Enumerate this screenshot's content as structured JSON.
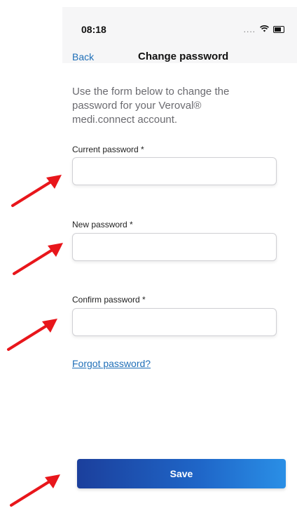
{
  "status_bar": {
    "time": "08:18",
    "signal": "....",
    "wifi_icon": "wifi-icon",
    "battery_icon": "battery-icon"
  },
  "nav": {
    "back_label": "Back",
    "title": "Change password"
  },
  "intro": "Use the form below to change the password for your Veroval® medi.connect account.",
  "fields": {
    "current": {
      "label": "Current password *",
      "value": ""
    },
    "new": {
      "label": "New password *",
      "value": ""
    },
    "confirm": {
      "label": "Confirm password *",
      "value": ""
    }
  },
  "forgot_link": "Forgot password?",
  "save_label": "Save",
  "colors": {
    "link": "#1f6fb8",
    "button_start": "#1b3f9c",
    "button_end": "#2a8fe6",
    "arrow": "#e8161b"
  }
}
